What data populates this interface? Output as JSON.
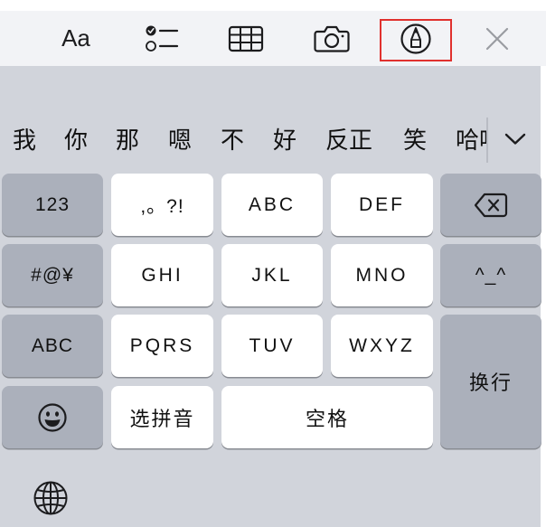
{
  "toolbar": {
    "format_label": "Aa",
    "icons": [
      "format-text-icon",
      "checklist-icon",
      "table-icon",
      "camera-icon",
      "markup-pen-icon",
      "close-icon"
    ],
    "highlight_color": "#e0312e"
  },
  "candidates": {
    "items": [
      "我",
      "你",
      "那",
      "嗯",
      "不",
      "好",
      "反正",
      "笑"
    ],
    "partial": "哈哈",
    "more_icon": "chevron-down-icon"
  },
  "keys": {
    "num": "123",
    "punct": ",。?!",
    "abc_key": "ABC",
    "def_key": "DEF",
    "symbols": "#@¥",
    "ghi": "GHI",
    "jkl": "JKL",
    "mno": "MNO",
    "emoticon": "^_^",
    "abc_mode": "ABC",
    "pqrs": "PQRS",
    "tuv": "TUV",
    "wxyz": "WXYZ",
    "pinyin": "选拼音",
    "space": "空格",
    "return": "换行",
    "delete_icon": "backspace-icon",
    "emoji_icon": "emoji-icon",
    "globe_icon": "globe-icon"
  },
  "colors": {
    "keyboard_bg": "#d1d4db",
    "toolbar_bg": "#f2f3f6",
    "key_light": "#ffffff",
    "key_dark": "#abb0bb"
  }
}
